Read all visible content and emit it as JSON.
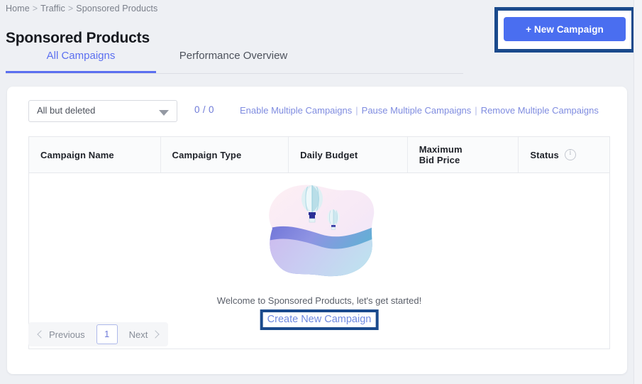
{
  "breadcrumb": {
    "items": [
      "Home",
      "Traffic",
      "Sponsored Products"
    ],
    "separator": ">"
  },
  "page_title": "Sponsored Products",
  "tabs": [
    {
      "label": "All Campaigns",
      "active": true
    },
    {
      "label": "Performance Overview",
      "active": false
    }
  ],
  "header_actions": {
    "new_campaign_label": "+ New Campaign",
    "new_campaign_highlighted": true
  },
  "filter": {
    "selected": "All but deleted",
    "caret_icon": "chevron-down-icon"
  },
  "counter": "0 / 0",
  "bulk_actions": {
    "enable": "Enable Multiple Campaigns",
    "pause": "Pause Multiple Campaigns",
    "remove": "Remove Multiple Campaigns",
    "separator": "|"
  },
  "table": {
    "columns": [
      {
        "label": "Campaign Name",
        "info_icon": false
      },
      {
        "label": "Campaign Type",
        "info_icon": false
      },
      {
        "label": "Daily Budget",
        "info_icon": false
      },
      {
        "label_line1": "Maximum",
        "label_line2": "Bid Price",
        "info_icon": false
      },
      {
        "label": "Status",
        "info_icon": true,
        "info_icon_name": "info-circle-icon"
      }
    ],
    "rows": []
  },
  "empty_state": {
    "illustration": "hot-air-balloons-landscape-illustration",
    "message": "Welcome to Sponsored Products, let's get started!",
    "cta_label": "Create New Campaign",
    "cta_highlighted": true
  },
  "pagination": {
    "previous_label": "Previous",
    "next_label": "Next",
    "current_page": "1"
  },
  "colors": {
    "page_background": "#eef0f4",
    "card_background": "#ffffff",
    "accent_blue": "#4a6ef0",
    "link_blue": "#7f8ce0",
    "highlight_box": "#1a4a8c",
    "tab_active": "#5b6ff0",
    "text_dark": "#16191f",
    "text_muted": "#7a7f8a"
  }
}
